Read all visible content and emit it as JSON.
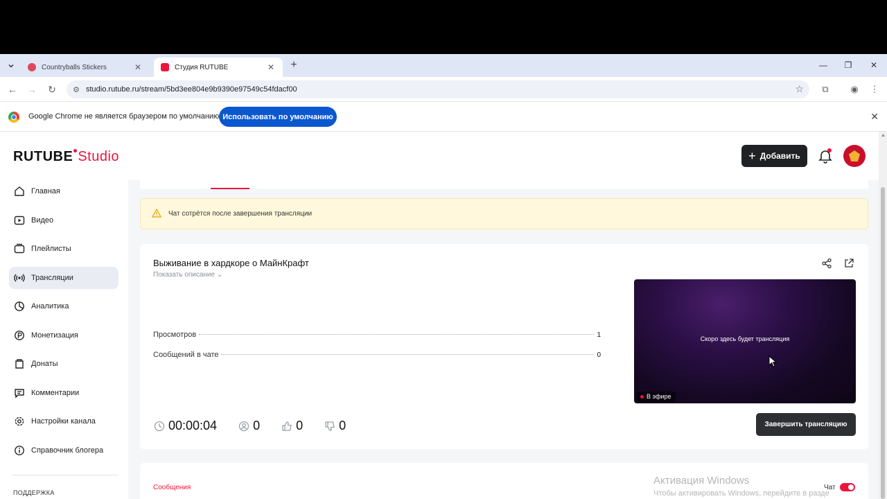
{
  "browser": {
    "tabs": [
      {
        "title": "Countryballs Stickers",
        "favicon_color": "#e0475c"
      },
      {
        "title": "Студия RUTUBE",
        "favicon_color": "#ed143b"
      }
    ],
    "url": "studio.rutube.ru/stream/5bd3ee804e9b9390e97549c54fdacf00"
  },
  "infobar": {
    "text": "Google Chrome не является браузером по умолчанию.",
    "button": "Использовать по умолчанию"
  },
  "header": {
    "logo_main": "RUTUBE",
    "logo_studio": "Studio",
    "add_button": "Добавить"
  },
  "sidebar": {
    "items": [
      {
        "label": "Главная",
        "icon": "home-icon"
      },
      {
        "label": "Видео",
        "icon": "video-icon"
      },
      {
        "label": "Плейлисты",
        "icon": "playlist-icon"
      },
      {
        "label": "Трансляции",
        "icon": "broadcast-icon",
        "active": true
      },
      {
        "label": "Аналитика",
        "icon": "analytics-icon"
      },
      {
        "label": "Монетизация",
        "icon": "monetization-icon"
      },
      {
        "label": "Донаты",
        "icon": "donations-icon"
      },
      {
        "label": "Комментарии",
        "icon": "comments-icon"
      },
      {
        "label": "Настройки канала",
        "icon": "settings-icon"
      },
      {
        "label": "Справочник блогера",
        "icon": "info-icon"
      }
    ],
    "support_heading": "ПОДДЕРЖКА"
  },
  "warning": {
    "text": "Чат сотрётся после завершения трансляции"
  },
  "stream": {
    "title": "Выживание в хардкоре о МайнКрафт",
    "show_description": "Показать описание",
    "stats": [
      {
        "label": "Просмотров",
        "value": "1"
      },
      {
        "label": "Сообщений в чате",
        "value": "0"
      }
    ],
    "preview_text": "Скоро здесь будет трансляция",
    "live_badge": "В эфире",
    "duration": "00:00:04",
    "viewers": "0",
    "likes": "0",
    "dislikes": "0",
    "end_button": "Завершить трансляцию"
  },
  "chat": {
    "tab_label": "Сообщения",
    "toggle_label": "Чат",
    "toggle_on": true
  },
  "watermark": {
    "line1": "Активация Windows",
    "line2": "Чтобы активировать Windows, перейдите в разде"
  },
  "colors": {
    "brand": "#ed143b",
    "dark_button": "#202124"
  }
}
